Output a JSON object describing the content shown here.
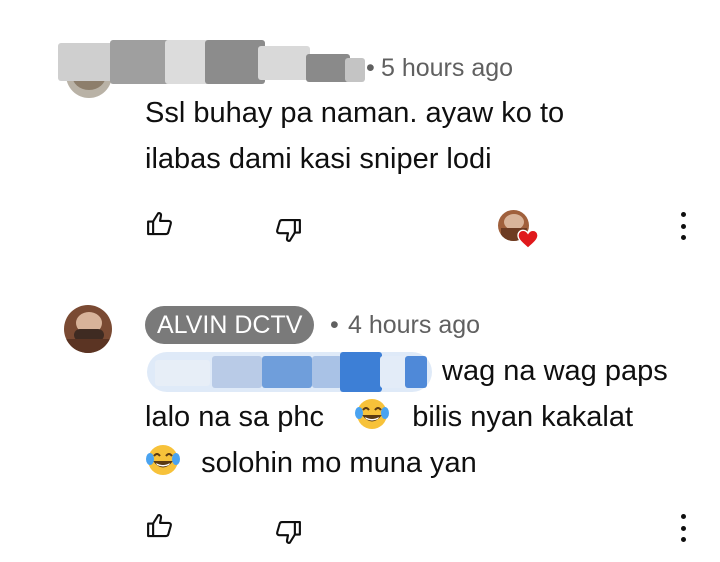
{
  "comments": [
    {
      "author": "",
      "time": "5 hours ago",
      "lines": [
        "Ssl buhay pa naman. ayaw ko to",
        "ilabas dami kasi sniper lodi"
      ],
      "actions": {
        "like": "like-icon",
        "dislike": "dislike-icon",
        "more": "more-vert-icon"
      },
      "hearted": true
    },
    {
      "author": "ALVIN DCTV",
      "time": "4 hours ago",
      "reply_prefix": "wag na wag paps",
      "line2_a": "lalo na sa phc",
      "line2_b": "bilis nyan kakalat",
      "line3": "solohin mo muna yan",
      "emoji": "face-with-tears-of-joy",
      "actions": {
        "like": "like-icon",
        "dislike": "dislike-icon",
        "more": "more-vert-icon"
      }
    }
  ],
  "colors": {
    "meta": "#606060",
    "pill": "#7a7a7a",
    "heart": "#e0191c",
    "mention": "#3d7fd6"
  }
}
